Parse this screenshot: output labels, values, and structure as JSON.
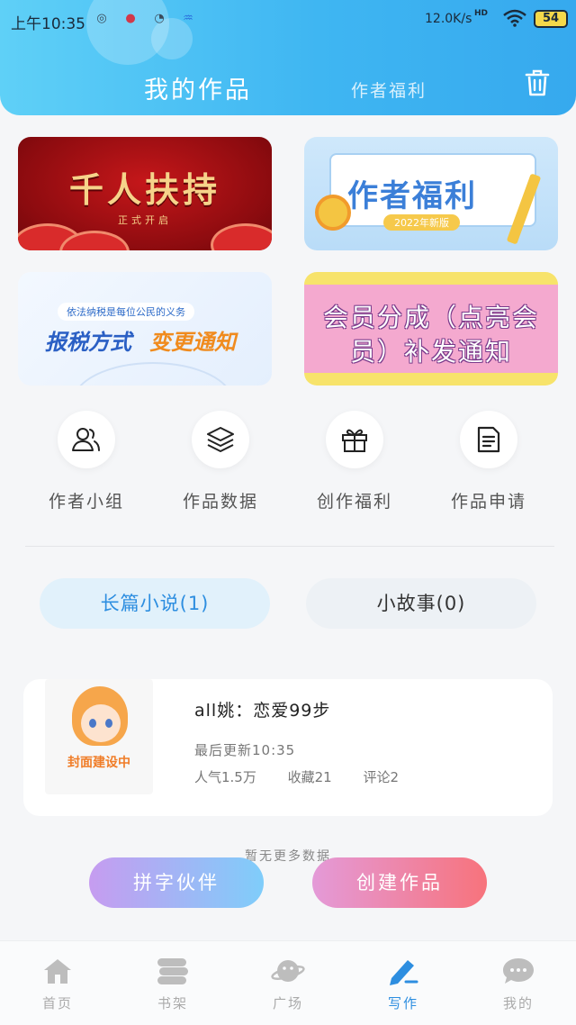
{
  "status_bar": {
    "time": "上午10:35",
    "network_speed": "12.0K/s",
    "signal_badge": "HD",
    "battery": "54"
  },
  "header": {
    "tabs": [
      {
        "label": "我的作品",
        "active": true
      },
      {
        "label": "作者福利",
        "active": false
      }
    ],
    "trash_icon": "trash-icon"
  },
  "banners": [
    {
      "title": "千人扶持",
      "subtitle": "正式开启"
    },
    {
      "title": "作者福利",
      "badge": "2022年新版"
    },
    {
      "tag": "依法纳税是每位公民的义务",
      "title_part1": "报税方式",
      "title_part2": "变更通知"
    },
    {
      "line1": "会员分成（点亮会",
      "line2": "员）补发通知"
    }
  ],
  "quick_actions": [
    {
      "label": "作者小组",
      "icon": "users-icon"
    },
    {
      "label": "作品数据",
      "icon": "layers-icon"
    },
    {
      "label": "创作福利",
      "icon": "gift-icon"
    },
    {
      "label": "作品申请",
      "icon": "document-icon"
    }
  ],
  "work_tabs": [
    {
      "label": "长篇小说(1)",
      "active": true
    },
    {
      "label": "小故事(0)",
      "active": false
    }
  ],
  "work": {
    "cover_caption": "封面建设中",
    "title": "all姚：恋爱99步",
    "last_updated": "最后更新10:35",
    "popularity": "人气1.5万",
    "favorites": "收藏21",
    "comments": "评论2"
  },
  "no_more_text": "暂无更多数据",
  "actions": {
    "partner": "拼字伙伴",
    "create": "创建作品"
  },
  "bottom_nav": [
    {
      "label": "首页",
      "icon": "home-icon",
      "active": false
    },
    {
      "label": "书架",
      "icon": "bookshelf-icon",
      "active": false
    },
    {
      "label": "广场",
      "icon": "planet-icon",
      "active": false
    },
    {
      "label": "写作",
      "icon": "pen-icon",
      "active": true
    },
    {
      "label": "我的",
      "icon": "chat-bubble-icon",
      "active": false
    }
  ],
  "colors": {
    "header_gradient_start": "#5fd0f7",
    "header_gradient_end": "#36a9ee",
    "accent_blue": "#2d8ee0",
    "create_button_end": "#f7737c"
  }
}
